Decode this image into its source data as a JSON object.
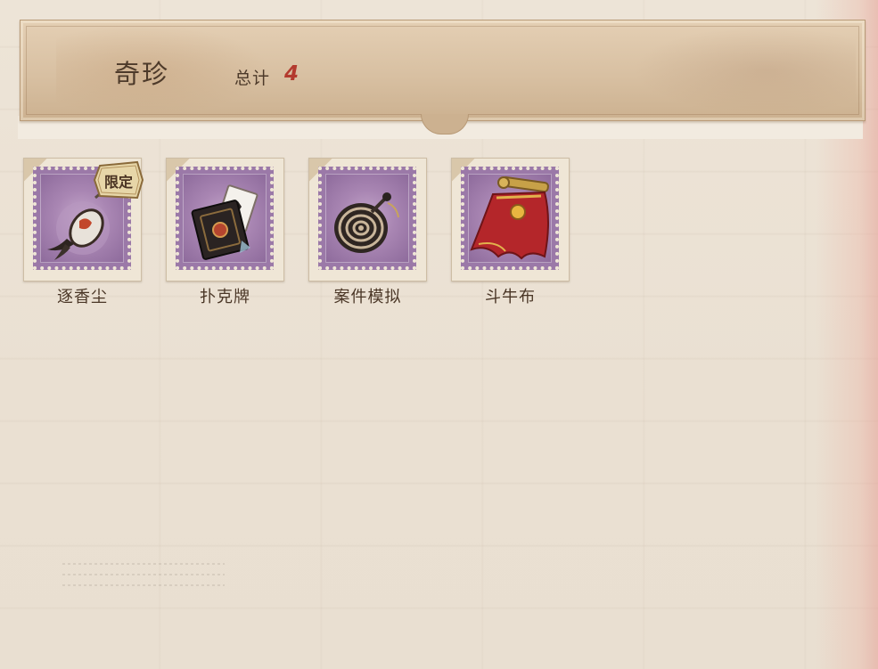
{
  "header": {
    "title": "奇珍",
    "total_label": "总计",
    "total_count": "4"
  },
  "items": [
    {
      "label": "逐香尘",
      "badge": "限定",
      "icon": "incense-pendant-icon"
    },
    {
      "label": "扑克牌",
      "badge": "",
      "icon": "playing-cards-icon"
    },
    {
      "label": "案件模拟",
      "badge": "",
      "icon": "spinning-top-icon"
    },
    {
      "label": "斗牛布",
      "badge": "",
      "icon": "bullfight-cape-icon"
    }
  ],
  "colors": {
    "header_bg": "#d8c0a2",
    "title_text": "#4d3a2a",
    "count_text": "#b33a2e",
    "stamp_purple": "#9b79a8",
    "paper_bg": "#ece3d6"
  }
}
